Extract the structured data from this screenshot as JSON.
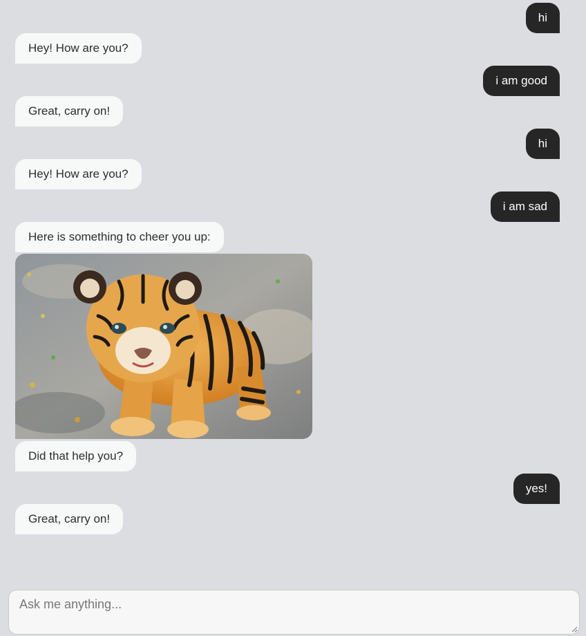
{
  "messages": [
    {
      "sender": "user",
      "text": "hi"
    },
    {
      "sender": "bot",
      "text": "Hey! How are you?"
    },
    {
      "sender": "user",
      "text": "i am good"
    },
    {
      "sender": "bot",
      "text": "Great, carry on!"
    },
    {
      "sender": "user",
      "text": "hi"
    },
    {
      "sender": "bot",
      "text": "Hey! How are you?"
    },
    {
      "sender": "user",
      "text": "i am sad"
    },
    {
      "sender": "bot",
      "text": "Here is something to cheer you up:"
    },
    {
      "sender": "bot",
      "type": "image",
      "image": "tiger-cub-photo"
    },
    {
      "sender": "bot",
      "text": "Did that help you?"
    },
    {
      "sender": "user",
      "text": "yes!"
    },
    {
      "sender": "bot",
      "text": "Great, carry on!"
    }
  ],
  "input": {
    "placeholder": "Ask me anything...",
    "value": ""
  },
  "colors": {
    "background": "#dcdde1",
    "bot_bubble": "#f7f8f8",
    "user_bubble": "#262626",
    "user_text": "#ffffff",
    "bot_text": "#2d2d2d"
  }
}
